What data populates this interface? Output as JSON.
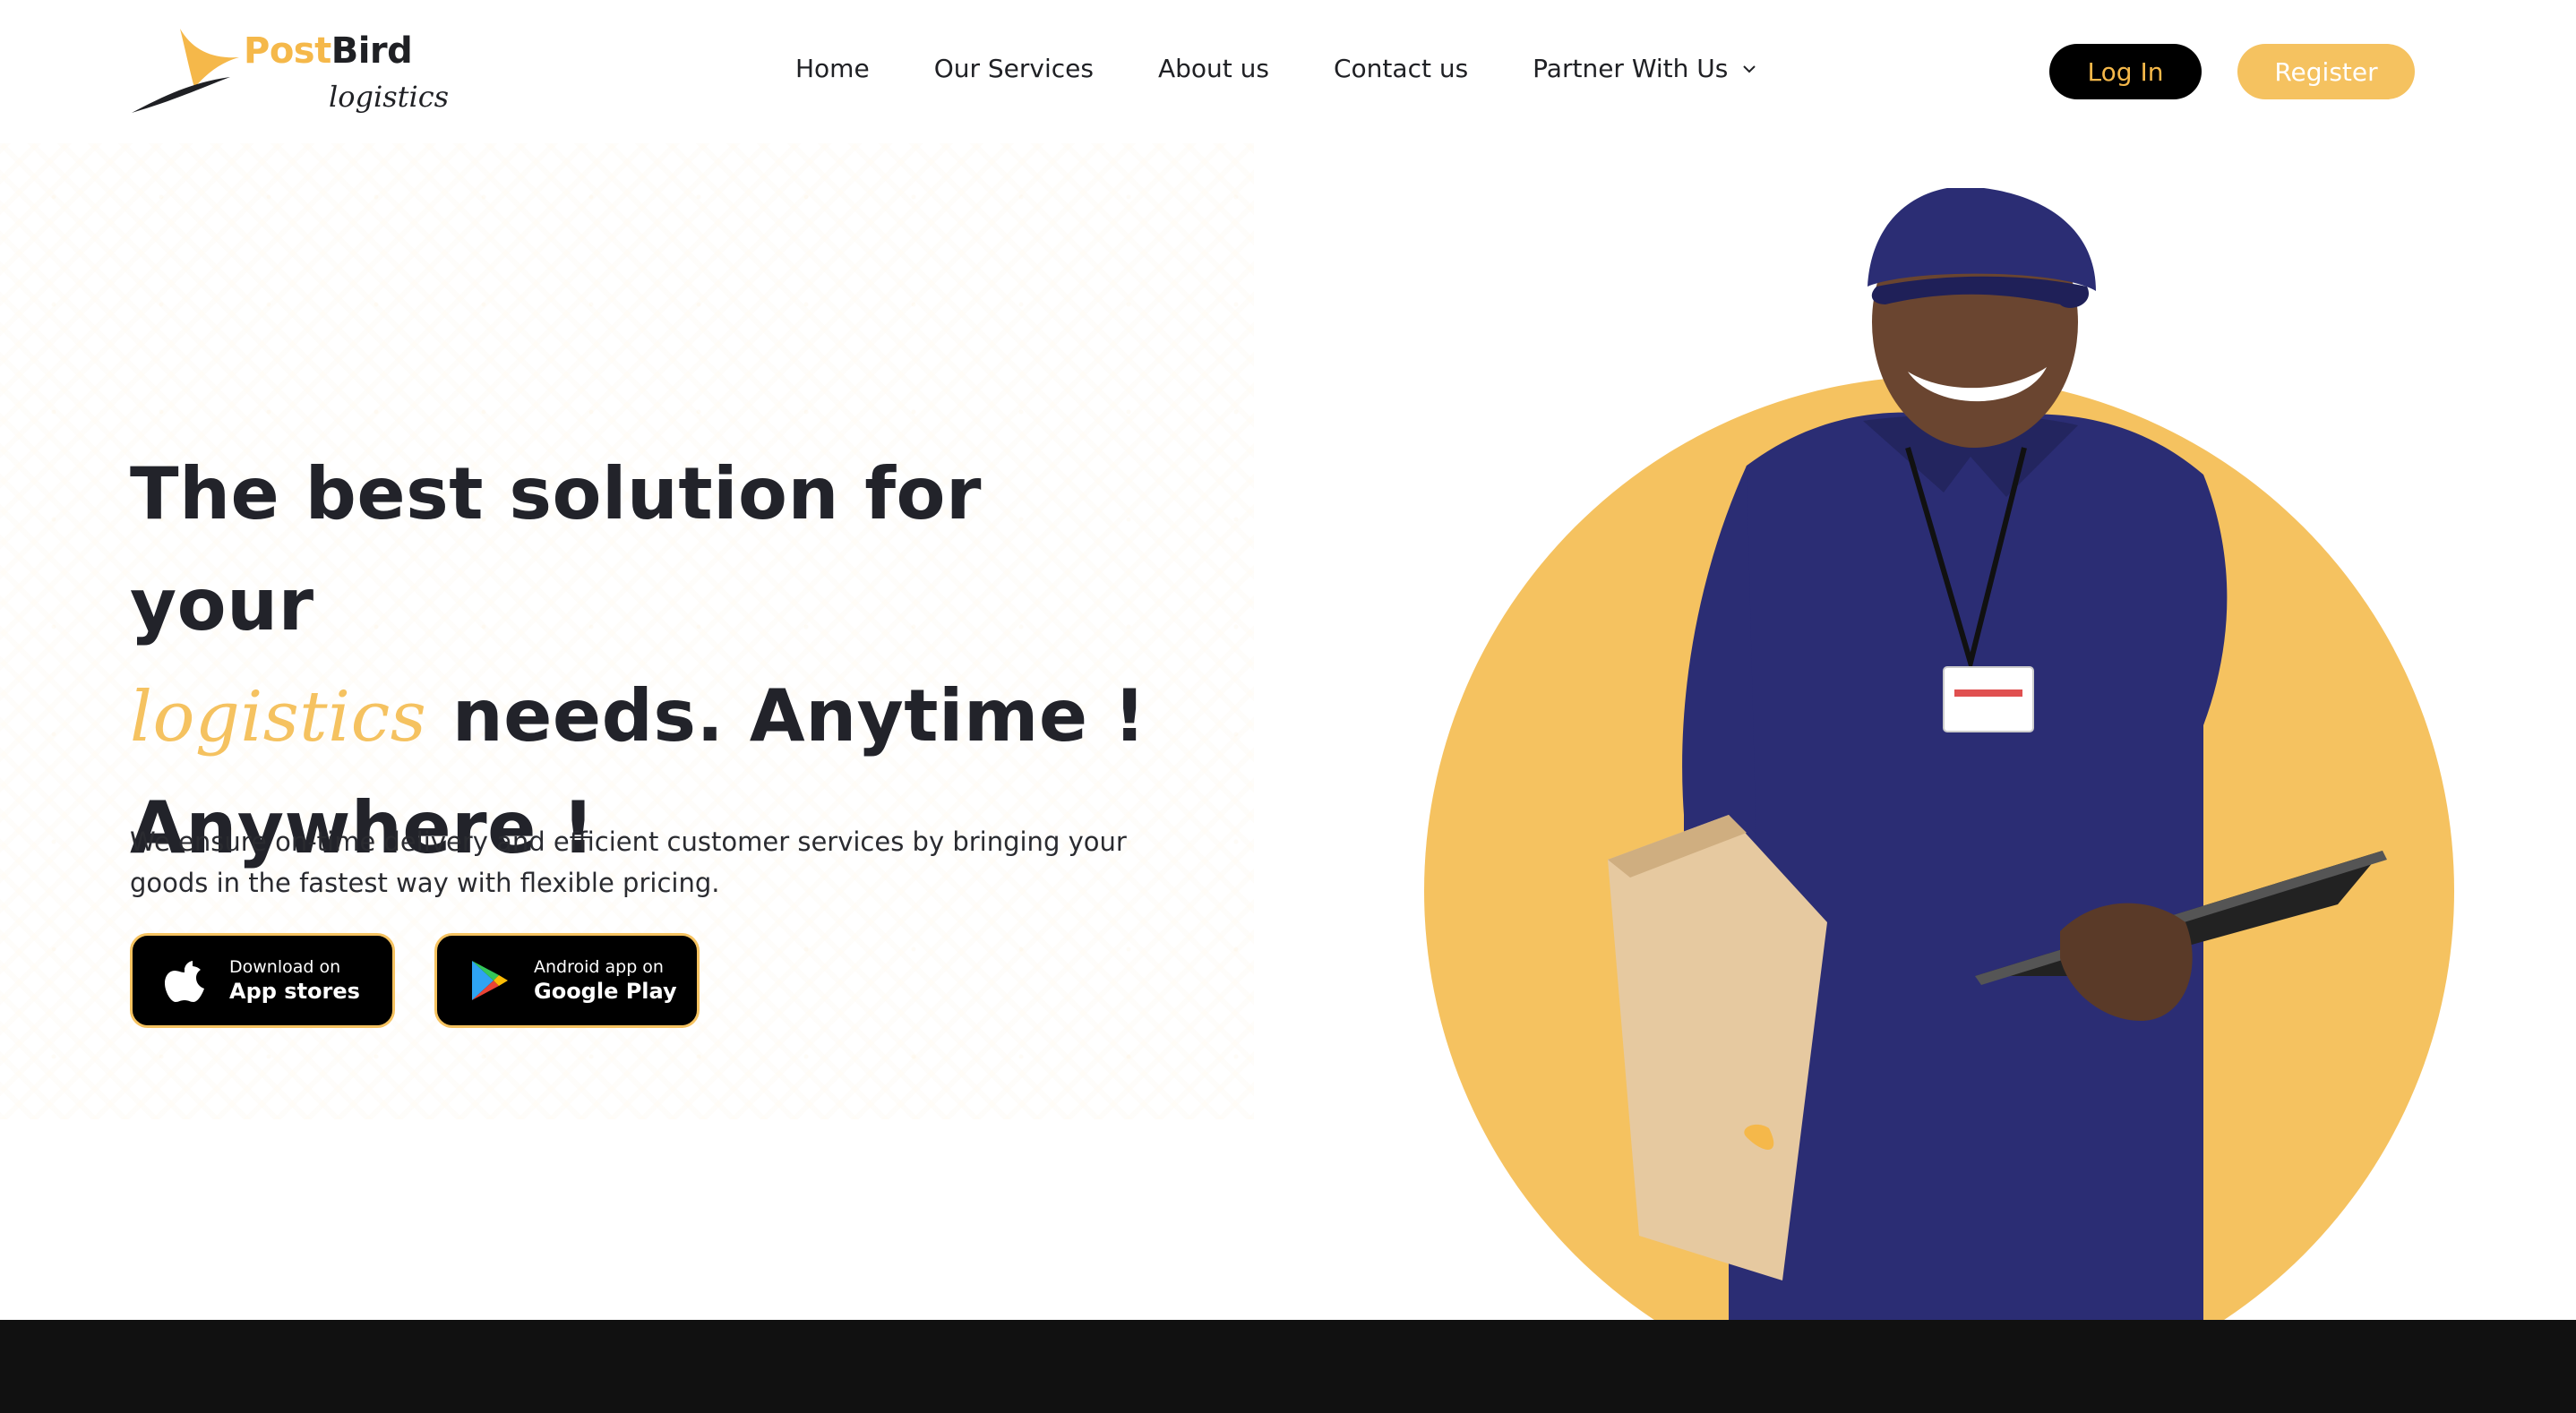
{
  "brand": {
    "name_part1": "Post",
    "name_part2": "Bird",
    "tagline": "logistics"
  },
  "nav": {
    "items": [
      {
        "label": "Home"
      },
      {
        "label": "Our Services"
      },
      {
        "label": "About us"
      },
      {
        "label": "Contact us"
      },
      {
        "label": "Partner With Us",
        "icon": "chevron-down-icon"
      }
    ]
  },
  "auth": {
    "login_label": "Log In",
    "register_label": "Register"
  },
  "hero": {
    "headline_line1": "The best solution for your",
    "headline_accent": "logistics",
    "headline_line2_rest": "needs. Anytime !",
    "headline_line3": "Anywhere !",
    "subtext": "We ensure on-time delivery and efficient customer services by bringing your goods in the fastest way with flexible pricing."
  },
  "stores": {
    "apple": {
      "small": "Download on",
      "big": "App stores",
      "icon": "apple-icon"
    },
    "google": {
      "small": "Android app on",
      "big": "Google Play",
      "icon": "google-play-icon"
    }
  },
  "colors": {
    "accent": "#f5c260",
    "dark": "#000000",
    "text": "#22232a",
    "footer": "#111111",
    "uniform": "#2b2d74"
  }
}
